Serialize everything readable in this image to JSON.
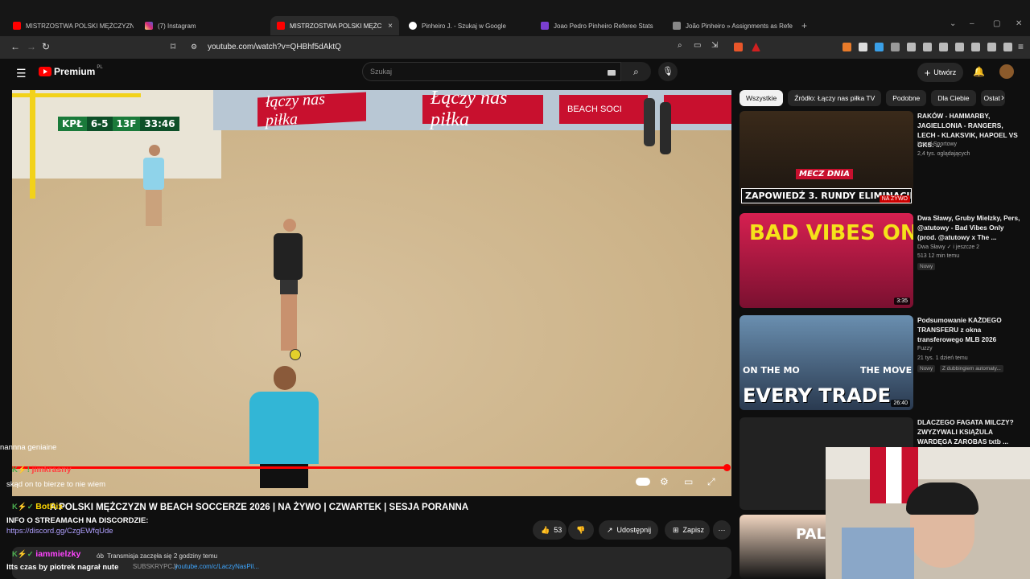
{
  "browser": {
    "tabs": [
      {
        "title": "MISTRZOSTWA POLSKI MĘŻCZYZN W",
        "icon": "youtube-icon",
        "active": false
      },
      {
        "title": "(7) Instagram",
        "icon": "instagram-icon",
        "active": false
      },
      {
        "title": "MISTRZOSTWA POLSKI MĘŻC",
        "icon": "youtube-icon",
        "active": true
      },
      {
        "title": "Pinheiro J. - Szukaj w Google",
        "icon": "google-icon",
        "active": false
      },
      {
        "title": "Joao Pedro Pinheiro Referee Stats",
        "icon": "stats-icon",
        "active": false
      },
      {
        "title": "João Pinheiro » Assignments as Refe",
        "icon": "page-icon",
        "active": false
      }
    ],
    "url": "youtube.com/watch?v=QHBhf5dAktQ"
  },
  "youtube": {
    "logo_text": "Premium",
    "logo_region": "PL",
    "search_placeholder": "Szukaj",
    "create_label": "Utwórz"
  },
  "video": {
    "scorebug": {
      "team": "KPŁ",
      "score": "6-5",
      "stage": "13F",
      "clock": "33:46"
    },
    "banner_text": "Łączy nas piłka",
    "banner_text2": "łączy nas piłka",
    "beach_label": "BEACH SOCI",
    "title": "A POLSKI MĘŻCZYZN W BEACH SOCCERZE 2026 | NA ŻYWO | CZWARTEK | SESJA PORANNA",
    "likes": "53",
    "share_label": "Udostępnij",
    "save_label": "Zapisz",
    "desc_views": "ób",
    "desc_started": "Transmisja zaczęła się 2 godziny temu",
    "desc_line2": "SUBSKRYPCJI",
    "desc_link": "youtube.com/c/LaczyNasPil..."
  },
  "chips": [
    "Wszystkie",
    "Źródło: Łączy nas piłka TV",
    "Podobne",
    "Dla Ciebie",
    "Ostat"
  ],
  "recommendations": [
    {
      "title": "RAKÓW - HAMMARBY, JAGIELLONIA - RANGERS, LECH - KLAKSVIK, HAPOEL VS GKS: ...",
      "channel": "Kanał Sportowy",
      "meta": "2,4 tys. oglądających",
      "thumb_text": "ZAPOWIEDŹ 3. RUNDY ELIMINACJI LK",
      "thumb_top": "MECZ DNIA",
      "live": "NA ŻYWO"
    },
    {
      "title": "Dwa Sławy, Gruby Mielzky, Pers, @atutowy - Bad Vibes Only (prod. @atutowy x The ...",
      "channel": "Dwa Sławy",
      "channel_extra": "i jeszcze 2",
      "meta": "513  12 min temu",
      "badge": "Nowy",
      "thumb_text": "BAD VIBES ONLY",
      "duration": "3:35"
    },
    {
      "title": "Podsumowanie KAŻDEGO TRANSFERU z okna transferowego MLB 2026",
      "channel": "Fuzzy",
      "meta": "21 tys.  1 dzień temu",
      "badge": "Nowy",
      "badge2": "Z dubbingiem automaty...",
      "thumb_text": "EVERY TRADE",
      "thumb_left": "ON THE MO",
      "thumb_right": "THE MOVE",
      "duration": "26:40"
    },
    {
      "title": "DLACZEGO FAGATA MILCZY? ZWYZYWALI KSIĄŻULA WARDĘGA ZAROBAS txtb ...",
      "thumb_text": "PALE"
    }
  ],
  "chat": [
    {
      "name": "",
      "text": "nannna geniaine",
      "color": "#ffffff"
    },
    {
      "name": "jimkrasny",
      "text": "",
      "color": "#ff4040"
    },
    {
      "name": "",
      "text": "skąd on to bierze to nie wiem",
      "color": "#ffffff"
    },
    {
      "name": "BotRix",
      "text": "",
      "color": "#ffd700"
    },
    {
      "name": "",
      "text": "INFO O STREAMACH NA DISCORDZIE:",
      "color": "#ffffff"
    },
    {
      "name": "",
      "text": "https://discord.gg/CzgEWfqUde",
      "color": "#b0a0ff"
    },
    {
      "name": "iammielzky",
      "text": "",
      "color": "#ff44ff"
    },
    {
      "name": "",
      "text": "Itts czas by piotrek nagrał nute",
      "color": "#ffffff"
    }
  ]
}
